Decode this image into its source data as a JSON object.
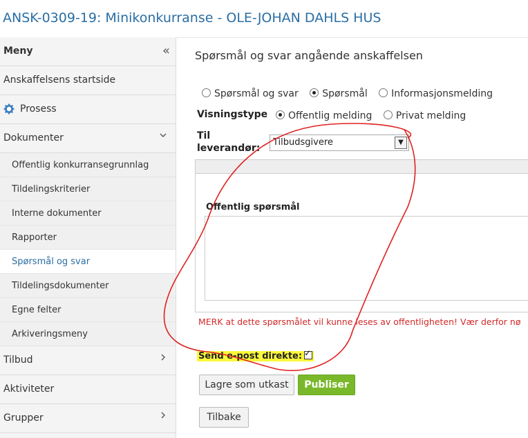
{
  "header": {
    "title": "ANSK-0309-19: Minikonkurranse - OLE-JOHAN DAHLS HUS"
  },
  "sidebar": {
    "menu_label": "Meny",
    "collapse_icon": "double-chevron-left-icon",
    "items": [
      {
        "label": "Anskaffelsens startside"
      },
      {
        "label": "Prosess",
        "icon": "gear-icon"
      },
      {
        "label": "Dokumenter",
        "expanded": true
      }
    ],
    "sub_items": [
      {
        "label": "Offentlig konkurransegrunnlag"
      },
      {
        "label": "Tildelingskriterier"
      },
      {
        "label": "Interne dokumenter"
      },
      {
        "label": "Rapporter"
      },
      {
        "label": "Spørsmål og svar",
        "active": true
      },
      {
        "label": "Tildelingsdokumenter"
      },
      {
        "label": "Egne felter"
      },
      {
        "label": "Arkiveringsmeny"
      }
    ],
    "bottom_items": [
      {
        "label": "Tilbud"
      },
      {
        "label": "Aktiviteter"
      },
      {
        "label": "Grupper"
      }
    ]
  },
  "main": {
    "title": "Spørsmål og svar angående anskaffelsen",
    "type_options": [
      "Spørsmål og svar",
      "Spørsmål",
      "Informasjonsmelding"
    ],
    "type_selected": "Spørsmål",
    "display_type_label": "Visningstype",
    "display_options": [
      "Offentlig melding",
      "Privat melding"
    ],
    "display_selected": "Offentlig melding",
    "to_supplier_label_line1": "Til",
    "to_supplier_label_line2": "leverandør:",
    "to_supplier_value": "Tilbudsgivere",
    "editor_heading": "Offentlig spørsmål",
    "warning": "MERK at dette spørsmålet vil kunne leses av offentligheten! Vær derfor nø",
    "send_email_label": "Send e-post direkte:",
    "send_email_checked": true,
    "buttons": {
      "save_draft": "Lagre som utkast",
      "publish": "Publiser",
      "back": "Tilbake"
    }
  },
  "colors": {
    "accent": "#2a6ea3",
    "warning": "#d12a2a",
    "publish_button": "#7ab82b",
    "highlight": "#fbf73a",
    "annotation": "#e02020"
  }
}
